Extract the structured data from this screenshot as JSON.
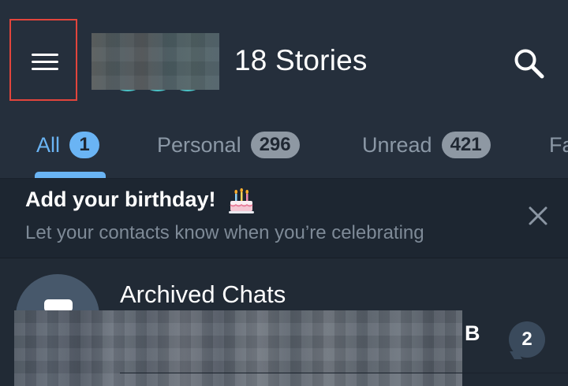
{
  "header": {
    "menu_icon": "hamburger-menu-icon",
    "title": "18 Stories",
    "search_icon": "search-icon",
    "story_color": "#4cc4c8",
    "highlight_color": "#e2453c"
  },
  "tabs": [
    {
      "label": "All",
      "badge": "1",
      "active": true
    },
    {
      "label": "Personal",
      "badge": "296",
      "active": false
    },
    {
      "label": "Unread",
      "badge": "421",
      "active": false
    },
    {
      "label": "Fa",
      "badge": "",
      "active": false
    }
  ],
  "accent_color": "#6ab4f4",
  "banner": {
    "title": "Add your birthday!",
    "cake_icon": "birthday-cake-icon",
    "subtitle": "Let your contacts know when you’re celebrating",
    "close_icon": "close-icon"
  },
  "archived": {
    "title": "Archived Chats",
    "archive_icon": "archive-box-icon",
    "preview_tail": "B",
    "unread_count": "2"
  }
}
